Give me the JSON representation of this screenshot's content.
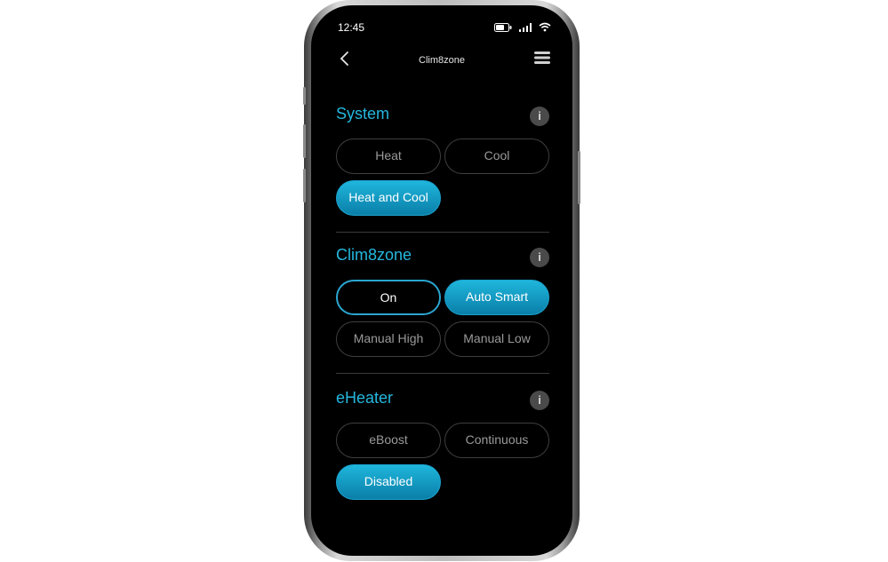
{
  "status_bar": {
    "time": "12:45"
  },
  "nav": {
    "title": "Clim8zone"
  },
  "sections": {
    "system": {
      "title": "System",
      "options": [
        "Heat",
        "Cool",
        "Heat and Cool"
      ]
    },
    "clim8zone": {
      "title": "Clim8zone",
      "options": [
        "On",
        "Auto Smart",
        "Manual High",
        "Manual Low"
      ]
    },
    "eheater": {
      "title": "eHeater",
      "options": [
        "eBoost",
        "Continuous",
        "Disabled"
      ]
    }
  },
  "info_glyph": "i",
  "colors": {
    "accent": "#25b7dd",
    "pill_active_top": "#1fb6dc",
    "pill_active_bottom": "#0a7fa8",
    "background": "#000000"
  }
}
